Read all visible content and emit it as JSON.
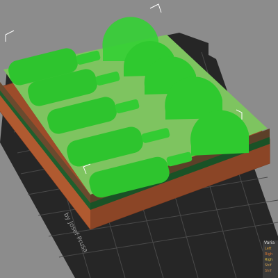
{
  "bed": {
    "logo_text": "by Josef Prusa"
  },
  "legend": {
    "title": "Varia",
    "rows": [
      "Left",
      "Righ",
      "Righ",
      "Shif",
      "Shif"
    ]
  },
  "colors": {
    "background": "#8c8c8c",
    "bed": "#2b2b2b",
    "grid": "#4a4a4a",
    "model_green": "#32c832",
    "plate_green": "#7ec460",
    "brown_layer": "#a0522d",
    "dark_green_layer": "#1f5e2c"
  }
}
